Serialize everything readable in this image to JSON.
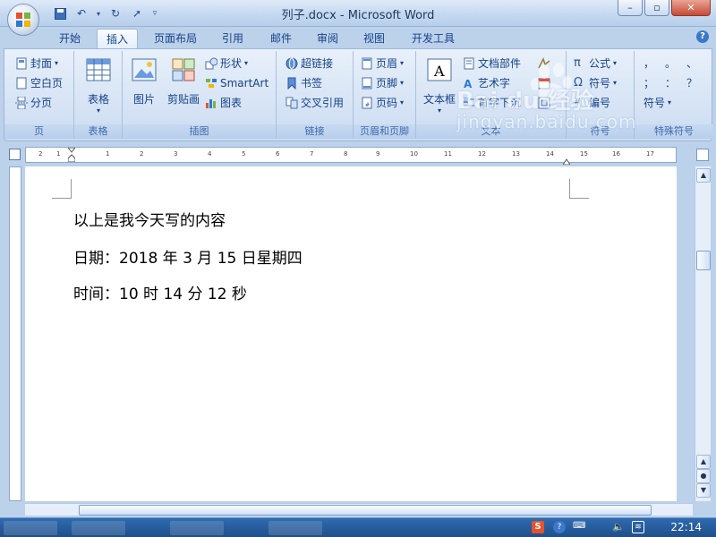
{
  "window": {
    "title": "列子.docx - Microsoft Word"
  },
  "tabs": [
    "开始",
    "插入",
    "页面布局",
    "引用",
    "邮件",
    "审阅",
    "视图",
    "开发工具"
  ],
  "active_tab": "插入",
  "ribbon": {
    "page": {
      "label": "页",
      "items": [
        "封面",
        "空白页",
        "分页"
      ]
    },
    "table": {
      "label": "表格",
      "button": "表格"
    },
    "illustrations": {
      "label": "插图",
      "picture": "图片",
      "clipart": "剪贴画",
      "shapes": "形状",
      "smartart": "SmartArt",
      "chart": "图表"
    },
    "links": {
      "label": "链接",
      "items": [
        "超链接",
        "书签",
        "交叉引用"
      ]
    },
    "header_footer": {
      "label": "页眉和页脚",
      "items": [
        "页眉",
        "页脚",
        "页码"
      ]
    },
    "text": {
      "label": "文本",
      "textbox": "文本框",
      "items": [
        "文档部件",
        "艺术字",
        "首字下沉"
      ]
    },
    "symbols": {
      "label": "符号",
      "items": [
        "公式",
        "符号",
        "编号"
      ]
    },
    "special": {
      "label": "特殊符号",
      "symbol_btn": "符号",
      "chars": [
        "，",
        "。",
        "、",
        "；",
        "：",
        "？"
      ]
    }
  },
  "document": {
    "lines": [
      "以上是我今天写的内容",
      "日期：2018 年 3 月 15 日星期四",
      "时间：10 时 14 分 12 秒"
    ]
  },
  "ruler": {
    "ticks": [
      "2",
      "1",
      "1",
      "2",
      "3",
      "4",
      "5",
      "6",
      "7",
      "8",
      "9",
      "10",
      "11",
      "12",
      "13",
      "14",
      "15",
      "16",
      "17"
    ]
  },
  "taskbar": {
    "clock": "22:14"
  },
  "watermark": {
    "brand": "Bai du 经验",
    "url": "jingyan.baidu.com"
  }
}
